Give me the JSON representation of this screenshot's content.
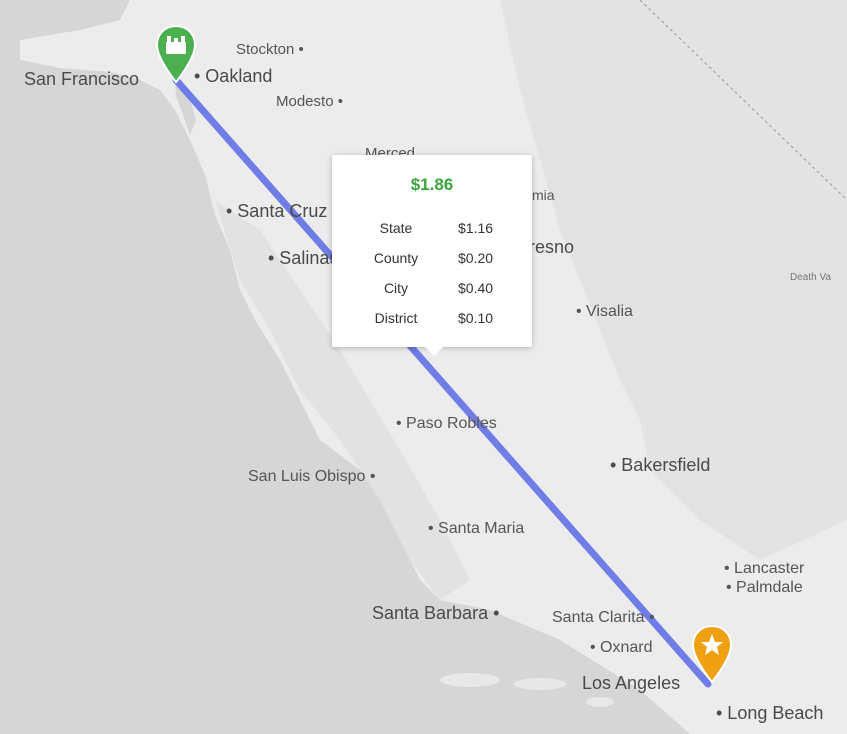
{
  "route": {
    "color": "#6a78e6",
    "origin": {
      "name": "San Francisco",
      "marker_icon": "factory-icon",
      "marker_color": "#4caf50"
    },
    "destination": {
      "name": "Los Angeles",
      "marker_icon": "star-icon",
      "marker_color": "#f0a010"
    }
  },
  "tooltip": {
    "total": "$1.86",
    "total_color": "#3aa53a",
    "rows": [
      {
        "label": "State",
        "value": "$1.16"
      },
      {
        "label": "County",
        "value": "$0.20"
      },
      {
        "label": "City",
        "value": "$0.40"
      },
      {
        "label": "District",
        "value": "$0.10"
      }
    ]
  },
  "cities": {
    "stockton": "Stockton •",
    "san_francisco": "San Francisco",
    "oakland": "• Oakland",
    "modesto": "Modesto •",
    "merced": "Merced",
    "santa_cruz": "• Santa Cruz",
    "salinas": "• Salinas",
    "mia": "mia",
    "fresno": "Fresno",
    "death_valley": "Death Va",
    "visalia": "• Visalia",
    "paso_robles": "• Paso Robles",
    "bakersfield": "• Bakersfield",
    "san_luis_obispo": "San Luis Obispo •",
    "santa_maria": "• Santa Maria",
    "lancaster": "• Lancaster",
    "palmdale": "• Palmdale",
    "santa_barbara": "Santa Barbara •",
    "santa_clarita": "Santa Clarita •",
    "oxnard": "• Oxnard",
    "los_angeles": "Los Angeles",
    "long_beach": "• Long Beach"
  }
}
